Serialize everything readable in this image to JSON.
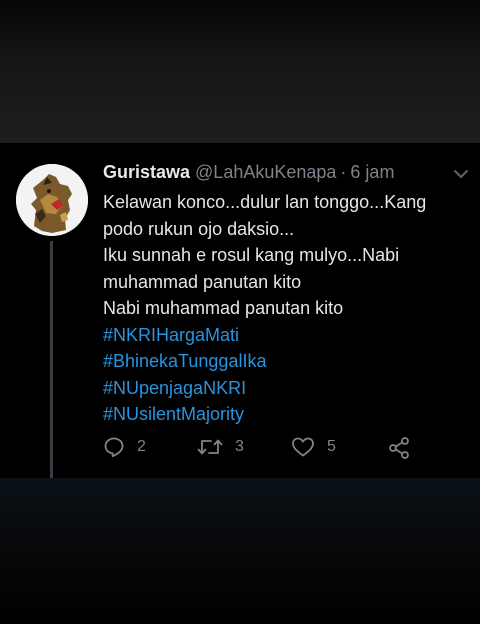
{
  "tweet": {
    "display_name": "Guristawa",
    "handle": "@LahAkuKenapa",
    "separator": "·",
    "time": "6 jam",
    "lines": [
      "Kelawan konco...dulur lan tonggo...Kang",
      "podo rukun ojo daksio...",
      "Iku sunnah e rosul kang mulyo...Nabi",
      "muhammad panutan kito",
      "Nabi muhammad panutan kito"
    ],
    "hashtags": [
      "#NKRIHargaMati",
      "#BhinekaTunggalIka",
      "#NUpenjagaNKRI",
      "#NUsilentMajority"
    ],
    "actions": {
      "reply": {
        "icon": "reply-icon",
        "count": "2"
      },
      "retweet": {
        "icon": "retweet-icon",
        "count": "3"
      },
      "like": {
        "icon": "heart-icon",
        "count": "5"
      },
      "share": {
        "icon": "share-icon"
      }
    }
  },
  "colors": {
    "background": "#000000",
    "text": "#e6e6e6",
    "secondary": "#7d848b",
    "hashtag": "#2a93de"
  }
}
